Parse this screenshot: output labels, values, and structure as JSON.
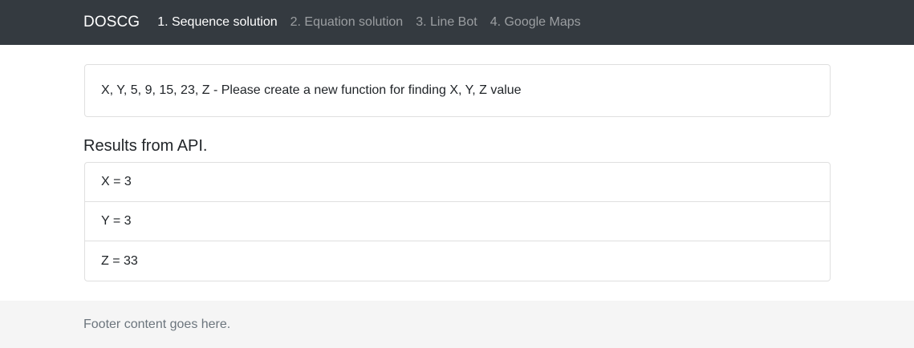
{
  "navbar": {
    "brand": "DOSCG",
    "links": [
      {
        "label": "1. Sequence solution",
        "active": true
      },
      {
        "label": "2. Equation solution",
        "active": false
      },
      {
        "label": "3. Line Bot",
        "active": false
      },
      {
        "label": "4. Google Maps",
        "active": false
      }
    ]
  },
  "question": {
    "text": "X, Y, 5, 9, 15, 23, Z - Please create a new function for finding X, Y, Z value"
  },
  "results": {
    "title": "Results from API.",
    "items": [
      {
        "text": "X = 3"
      },
      {
        "text": "Y = 3"
      },
      {
        "text": "Z = 33"
      }
    ]
  },
  "footer": {
    "text": "Footer content goes here."
  },
  "colors": {
    "navbar_bg": "#343a40",
    "footer_bg": "#f5f5f5",
    "muted_text": "#6c757d"
  }
}
